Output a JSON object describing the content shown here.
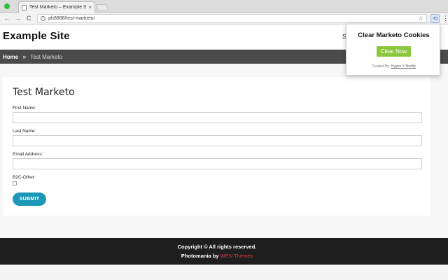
{
  "browser": {
    "tab_title": "Test Marketo – Example Site",
    "tab_close": "×",
    "url": "ph8888/test-marketo/",
    "nav_back": "←",
    "nav_forward": "→",
    "nav_reload": "C",
    "info_glyph": "i",
    "star_glyph": "☆",
    "ext_glyph": "⟲",
    "menu_glyph": "⋮"
  },
  "site": {
    "title": "Example Site",
    "nav_peek": "S"
  },
  "breadcrumb": {
    "home": "Home",
    "separator": "»",
    "current": "Test Marketo"
  },
  "form": {
    "title": "Test Marketo",
    "first_name_label": "First Name:",
    "last_name_label": "Last Name:",
    "email_label": "Email Address:",
    "b2c_label": "B2C-Other:",
    "submit_label": "SUBMIT"
  },
  "footer": {
    "copyright": "Copyright © All rights reserved.",
    "credit_prefix": "Photomania by ",
    "credit_link": "WEN Themes"
  },
  "popup": {
    "title": "Clear Marketo Cookies",
    "button": "Clear Now",
    "credit_prefix": "Created By: ",
    "credit_author": "Hygen X Modify"
  },
  "colors": {
    "submit": "#1d98b8",
    "popup_button": "#8cc63f",
    "breadcrumb_bg": "#4a4a4a",
    "footer_bg": "#1e1e1e",
    "credit_link": "#e8334a"
  }
}
